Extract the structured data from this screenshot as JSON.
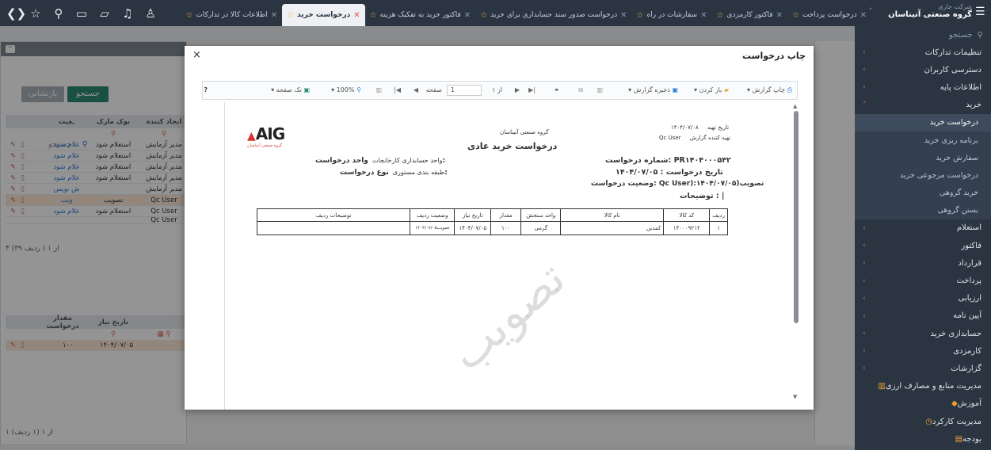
{
  "topbar": {
    "company_label": "شرکت جاری",
    "company_name": "گروه صنعتی آتیناسان",
    "tabs": [
      {
        "label": "درخواست پرداخت",
        "active": false
      },
      {
        "label": "فاکتور کارمزدی",
        "active": false
      },
      {
        "label": "سفارشات در راه",
        "active": false
      },
      {
        "label": "درخواست صدور سند حسابداری برای خرید",
        "active": false
      },
      {
        "label": "فاکتور خرید به تفکیک هزینه",
        "active": false
      },
      {
        "label": "درخواست خرید",
        "active": true
      },
      {
        "label": "اطلاعات کالا در تدارکات",
        "active": false
      }
    ]
  },
  "sidebar": {
    "search_placeholder": "جستجو",
    "items": [
      {
        "label": "تنظیمات تدارکات",
        "type": "parent"
      },
      {
        "label": "دسترسی کاربران",
        "type": "parent"
      },
      {
        "label": "اطلاعات پایه",
        "type": "parent"
      },
      {
        "label": "خرید",
        "type": "open"
      },
      {
        "label": "درخواست خرید",
        "type": "sub-active"
      },
      {
        "label": "برنامه ریزی خرید",
        "type": "sub"
      },
      {
        "label": "سفارش خرید",
        "type": "sub"
      },
      {
        "label": "درخواست مرجوعی خرید",
        "type": "sub"
      },
      {
        "label": "خرید گروهی",
        "type": "sub"
      },
      {
        "label": "بستن گروهی",
        "type": "sub"
      },
      {
        "label": "استعلام",
        "type": "parent"
      },
      {
        "label": "فاکتور",
        "type": "parent"
      },
      {
        "label": "قرارداد",
        "type": "parent"
      },
      {
        "label": "پرداخت",
        "type": "parent"
      },
      {
        "label": "ارزیابی",
        "type": "parent"
      },
      {
        "label": "آیین نامه",
        "type": "parent"
      },
      {
        "label": "حسابداری خرید",
        "type": "parent"
      },
      {
        "label": "کارمزدی",
        "type": "parent"
      },
      {
        "label": "گزارشات",
        "type": "parent"
      },
      {
        "label": "مدیریت منابع و مصارف ارزی",
        "type": "module"
      },
      {
        "label": "آموزش",
        "type": "module"
      },
      {
        "label": "مدیریت کارکرد",
        "type": "module"
      },
      {
        "label": "بودجه",
        "type": "module"
      }
    ]
  },
  "left_panel": {
    "search_button": "جستجو",
    "reset_button": "بازنشانی",
    "search_placeholder": "جستجو...",
    "grid1_headers": [
      "ایجاد کننده",
      "بوک مارک",
      "ـعیت"
    ],
    "grid1_rows": [
      {
        "creator": "مدیر آزمایش",
        "bookmark": "استعلام شود",
        "status": "علام شود"
      },
      {
        "creator": "مدیر آزمایش",
        "bookmark": "استعلام شود",
        "status": "علام شود"
      },
      {
        "creator": "مدیر آزمایش",
        "bookmark": "استعلام شود",
        "status": "علام شود"
      },
      {
        "creator": "مدیر آزمایش",
        "bookmark": "استعلام شود",
        "status": "علام شود"
      },
      {
        "creator": "مدیر آزمایش",
        "bookmark": "",
        "status": "ش نویس"
      },
      {
        "creator": "Qc User",
        "bookmark": "تصویب",
        "status": "ویب"
      },
      {
        "creator": "Qc User",
        "bookmark": "استعلام شود",
        "status": "علام شود"
      },
      {
        "creator": "Qc User",
        "bookmark": "",
        "status": ""
      }
    ],
    "pager1": "۴  از  ۱  ( ردیف ۳۹)",
    "grid2_headers": [
      "تاریخ نیاز",
      "مقدار درخواست"
    ],
    "grid2_rows": [
      {
        "date": "۱۴۰۴/۰۷/۰۵",
        "qty": "۱۰۰"
      }
    ],
    "pager2": "۱  از  ۱  (۱ ردیف)"
  },
  "modal": {
    "title": "چاپ درخواست",
    "close": "×",
    "toolbar": {
      "print_report": "چاپ گزارش",
      "open": "باز کردن",
      "save_report": "ذخیره گزارش",
      "page_label": "صفحه",
      "page_value": "1",
      "of_label": "از ۱",
      "zoom": "100%",
      "single_page": "تک صفحه",
      "help": "?"
    },
    "report": {
      "company": "گروه صنعتی آتیناسان",
      "title": "درخواست خرید عادی",
      "print_date_label": "تاریخ تهیه",
      "print_date": "۱۴۰۴/۰۷/۰۸",
      "preparer_label": "تهیه کننده گزارش",
      "preparer": "Qc User",
      "logo_text": "AIG",
      "logo_sub": "گروه صنعتی آتیناسان",
      "req_no": "شماره درخواست: PR۱۴۰۴۰۰۰۵۴۲",
      "req_date": "تاریخ درخواست : ۱۴۰۴/۰۷/۰۵",
      "req_status": "وضعیت درخواست: Qc User):۱۴۰۴/۰۷/۰۵)تصویب",
      "notes": "توضیحات :  |",
      "unit_label": "واحد درخواست:",
      "unit_value": "واحد حسابداری کارخانجات",
      "type_label": "نوع درخواست:",
      "type_value": "طبقه بندی مستوری",
      "watermark": "تصویب",
      "table_headers": [
        "ردیف",
        "کد کالا",
        "نام کالا",
        "واحد سنجش",
        "مقدار",
        "تاریخ نیاز",
        "وضعیت ردیف",
        "توضیحات ردیف"
      ],
      "table_rows": [
        [
          "۱",
          "۱۴۰۰۰۹۲۱۲",
          "کمدین",
          "گرمی",
          "۱۰۰",
          "۱۴۰۴/۰۷/۰۵",
          "تصویب۱۴۰۴/۰۷/۰۵",
          ""
        ]
      ]
    }
  }
}
